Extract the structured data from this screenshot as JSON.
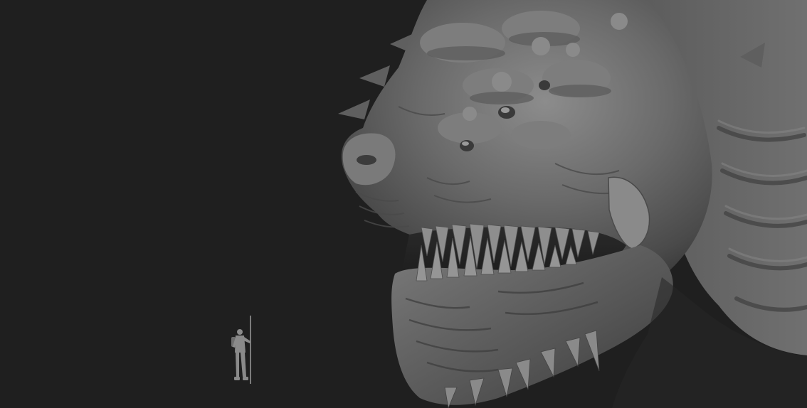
{
  "viewport": {
    "background": "#1f1f1f",
    "content": "sculpt-render"
  },
  "subjects": {
    "creature": {
      "icon": "creature-head-sculpt",
      "color": "#6b6b6b"
    },
    "human_figure": {
      "icon": "human-figure-sculpt",
      "color": "#8a8a8a"
    }
  }
}
